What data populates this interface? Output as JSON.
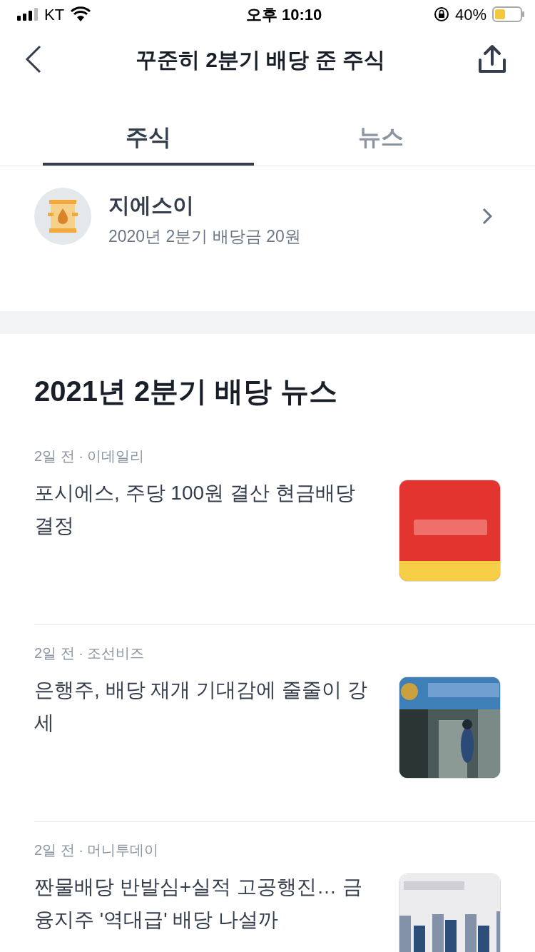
{
  "status_bar": {
    "carrier": "KT",
    "time": "오후 10:10",
    "battery": "40%"
  },
  "header": {
    "title": "꾸준히 2분기 배당 준 주식"
  },
  "tabs": [
    {
      "label": "주식",
      "selected": true
    },
    {
      "label": "뉴스",
      "selected": false
    }
  ],
  "stock": {
    "name": "지에스이",
    "detail": "2020년 2분기 배당금 20원"
  },
  "news_section": {
    "title": "2021년 2분기 배당 뉴스",
    "items": [
      {
        "meta": "2일 전 · 이데일리",
        "headline": "포시에스, 주당 100원 결산 현금배당 결정",
        "thumbnail": {
          "kind": "logo"
        }
      },
      {
        "meta": "2일 전 · 조선비즈",
        "headline": "은행주, 배당 재개 기대감에 줄줄이 강세"
      },
      {
        "meta": "2일 전 · 머니투데이",
        "headline": "짠물배당 반발심+실적 고공행진… 금융지주 '역대급' 배당 나설까",
        "thumbnail": {
          "kind": "chart"
        }
      }
    ]
  }
}
